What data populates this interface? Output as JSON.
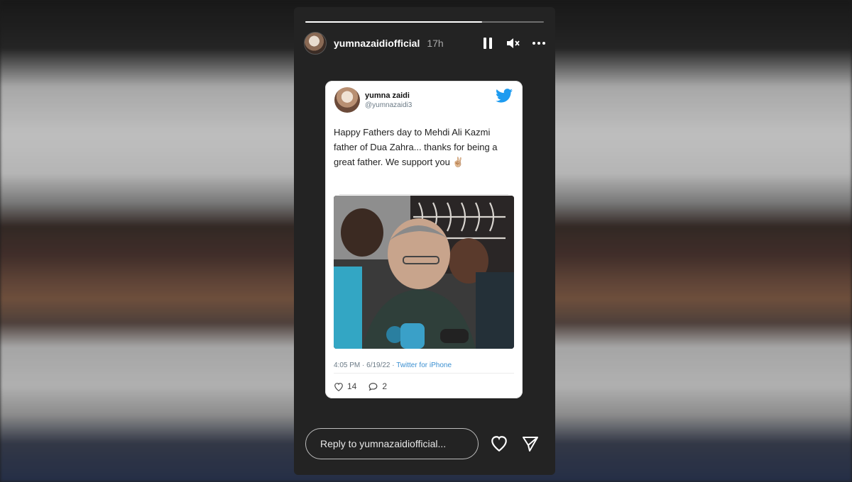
{
  "story": {
    "progress": 0.74,
    "username": "yumnazaidiofficial",
    "time_ago": "17h",
    "controls": {
      "pause_icon": "pause-icon",
      "mute_icon": "mute-icon",
      "more_icon": "more-icon"
    }
  },
  "tweet": {
    "name": "yumna zaidi",
    "handle": "@yumnazaidi3",
    "text": "Happy Fathers day to Mehdi Ali Kazmi father of Dua Zahra... thanks for being a great father. We support you ✌🏼",
    "meta_time": "4:05 PM · 6/19/22 · ",
    "meta_source": "Twitter for iPhone",
    "likes": "14",
    "replies": "2",
    "brand_color": "#1d9bf0"
  },
  "reply": {
    "placeholder": "Reply to yumnazaidiofficial..."
  },
  "colors": {
    "story_bg": "#232323",
    "text_light": "#ffffff",
    "muted": "#a8a8a8"
  }
}
